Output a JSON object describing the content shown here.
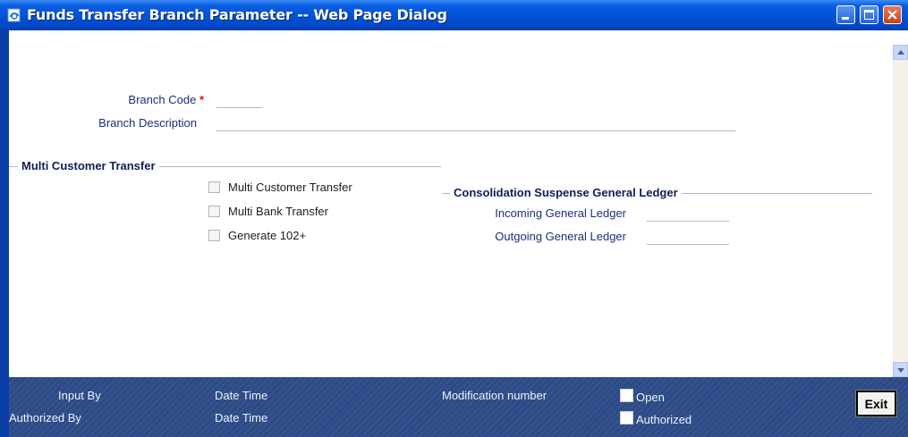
{
  "window": {
    "title": "Funds Transfer Branch Parameter -- Web Page Dialog",
    "icon": "ie-page-icon",
    "controls": [
      "minimize-icon",
      "maximize-icon",
      "close-icon"
    ]
  },
  "form": {
    "branch_code_label": "Branch Code",
    "required_marker": "*",
    "branch_code_value": "",
    "branch_description_label": "Branch Description",
    "branch_description_value": ""
  },
  "multi_customer_section": {
    "title": "Multi Customer Transfer",
    "options": [
      {
        "label": "Multi Customer Transfer",
        "checked": false
      },
      {
        "label": "Multi Bank Transfer",
        "checked": false
      },
      {
        "label": "Generate 102+",
        "checked": false
      }
    ]
  },
  "consolidation_section": {
    "title": "Consolidation Suspense General Ledger",
    "incoming_label": "Incoming General Ledger",
    "incoming_value": "",
    "outgoing_label": "Outgoing General Ledger",
    "outgoing_value": ""
  },
  "footer": {
    "input_by": "Input By",
    "authorized_by": "Authorized By",
    "date_time_1": "Date Time",
    "date_time_2": "Date Time",
    "modification_number": "Modification number",
    "open": "Open",
    "authorized": "Authorized",
    "exit": "Exit"
  },
  "colors": {
    "title_bar": "#0354d8",
    "label_text": "#1a2f7a",
    "footer_bg": "#2c4a86",
    "required": "#e01010"
  }
}
